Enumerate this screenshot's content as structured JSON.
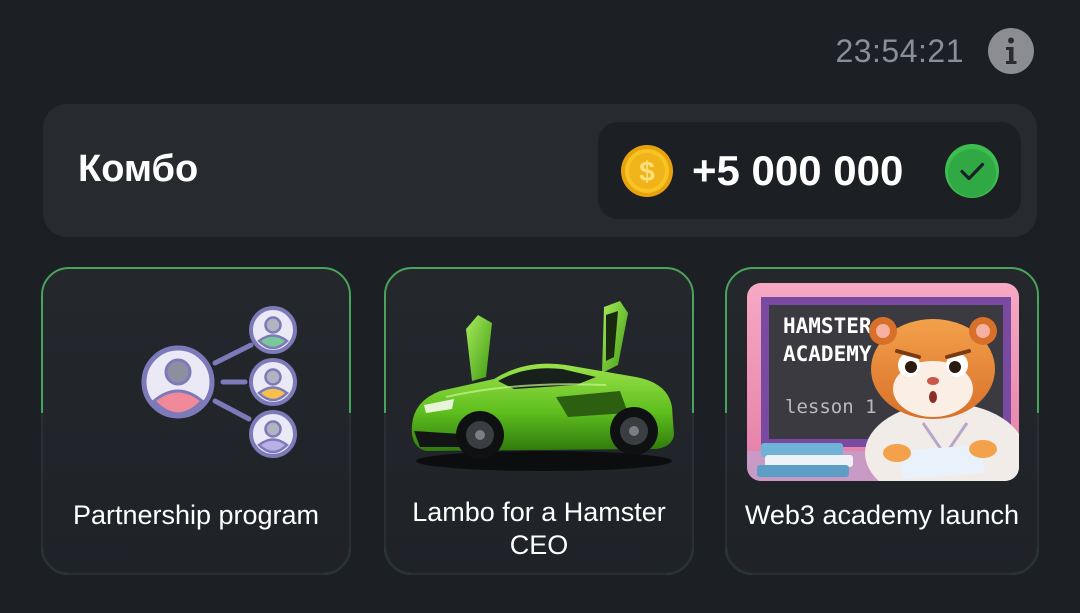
{
  "header": {
    "timer": "23:54:21",
    "info_icon": "info-icon"
  },
  "combo": {
    "title": "Комбо",
    "reward": "+5 000 000",
    "coin_icon": "coin-icon",
    "status_icon": "check-icon",
    "status_color": "#3dbd4f"
  },
  "cards": [
    {
      "label": "Partnership program",
      "image": "partnership-network-icon"
    },
    {
      "label": "Lambo for a Hamster CEO",
      "image": "green-sports-car-image"
    },
    {
      "label": "Web3 academy launch",
      "image": "hamster-academy-image",
      "image_text": [
        "HAMSTER",
        "ACADEMY",
        "lesson 1"
      ]
    }
  ],
  "colors": {
    "background": "#1c1f24",
    "card_border": "#4aa35a",
    "panel": "#272a2f"
  }
}
